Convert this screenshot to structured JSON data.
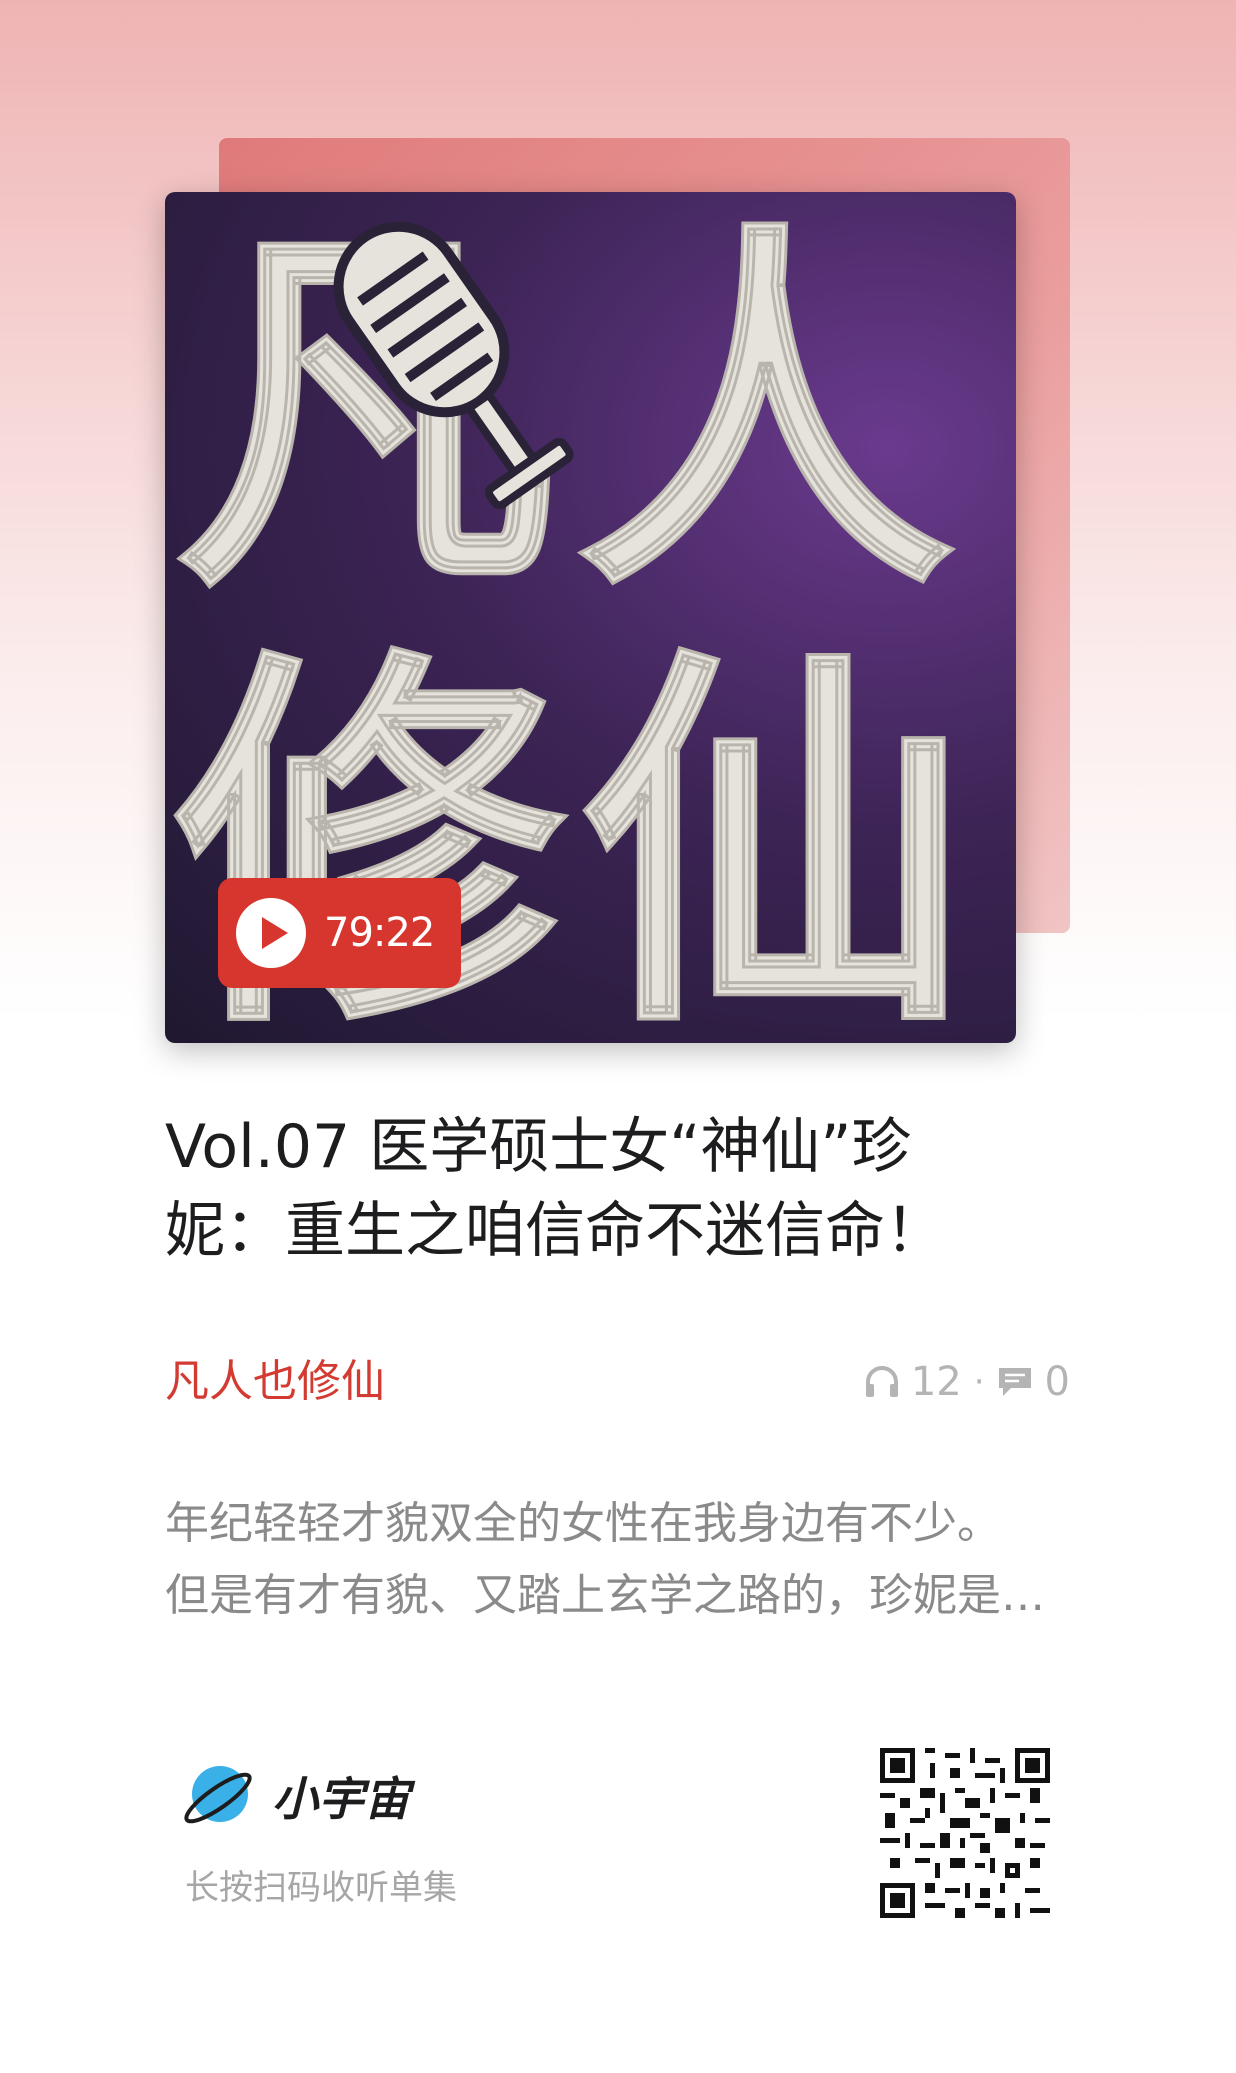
{
  "cover": {
    "chars": [
      "凡",
      "人",
      "修",
      "仙"
    ],
    "duration": "79:22"
  },
  "episode": {
    "title_line1": "Vol.07 医学硕士女“神仙”珍",
    "title_line2": "妮：重生之咱信命不迷信命！",
    "podcast_name": "凡人也修仙",
    "listen_count": "12",
    "comment_count": "0",
    "separator": "·",
    "description_line1": "年纪轻轻才貌双全的女性在我身边有不少。",
    "description_line2": "但是有才有貌、又踏上玄学之路的，珍妮是…"
  },
  "footer": {
    "brand_name": "小宇宙",
    "scan_hint": "长按扫码收听单集"
  },
  "colors": {
    "accent_red": "#d33a31",
    "badge_red": "#d7362f",
    "brand_blue": "#3ab0e8"
  }
}
